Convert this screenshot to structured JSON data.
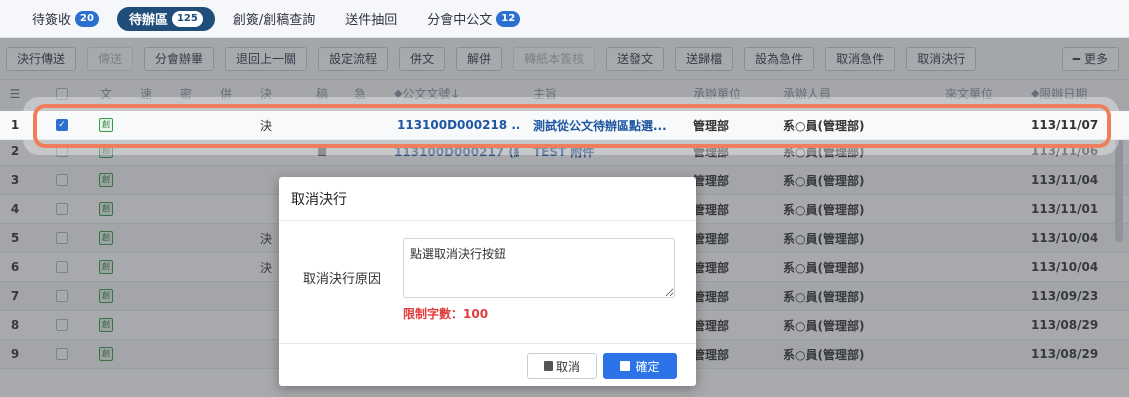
{
  "tabs": [
    {
      "label": "待簽收",
      "badge": "20"
    },
    {
      "label": "待辦區",
      "badge": "125"
    },
    {
      "label": "創簽/創稿查詢",
      "badge": ""
    },
    {
      "label": "送件抽回",
      "badge": ""
    },
    {
      "label": "分會中公文",
      "badge": "12"
    }
  ],
  "toolbar": {
    "buttons": [
      "決行傳送",
      "傳送",
      "分會辦畢",
      "退回上一關",
      "設定流程",
      "併文",
      "解併",
      "轉紙本簽核",
      "送發文",
      "送歸檔",
      "設為急件",
      "取消急件",
      "取消決行"
    ],
    "more": "更多"
  },
  "table": {
    "headers": {
      "wen": "文",
      "su": "速",
      "mi": "密",
      "bing": "併",
      "jue": "決",
      "gao": "稿",
      "ji": "急",
      "docno": "公文文號",
      "subject": "主旨",
      "unit": "承辦單位",
      "person": "承辦人員",
      "from": "來文單位",
      "date": "限辦日期"
    },
    "rows": [
      {
        "num": "1",
        "checked": true,
        "wen": "創",
        "jue": "決",
        "gao": false,
        "docno": "113100D000218 ...",
        "subject": "測試從公文待辦區點選...",
        "unit": "管理部",
        "person": "系○員(管理部)",
        "date": "113/11/07"
      },
      {
        "num": "2",
        "checked": false,
        "wen": "創",
        "jue": "",
        "gao": true,
        "docno": "113100D000217 (線)",
        "subject": "TEST 附件",
        "unit": "管理部",
        "person": "系○員(管理部)",
        "date": "113/11/06"
      },
      {
        "num": "3",
        "checked": false,
        "wen": "創",
        "jue": "",
        "gao": false,
        "docno": "",
        "subject": "",
        "unit": "管理部",
        "person": "系○員(管理部)",
        "date": "113/11/04"
      },
      {
        "num": "4",
        "checked": false,
        "wen": "創",
        "jue": "",
        "gao": false,
        "docno": "",
        "subject": "",
        "unit": "管理部",
        "person": "系○員(管理部)",
        "date": "113/11/01"
      },
      {
        "num": "5",
        "checked": false,
        "wen": "創",
        "jue": "決",
        "gao": false,
        "docno": "",
        "subject": "",
        "unit": "管理部",
        "person": "系○員(管理部)",
        "date": "113/10/04"
      },
      {
        "num": "6",
        "checked": false,
        "wen": "創",
        "jue": "決",
        "gao": false,
        "docno": "",
        "subject": "",
        "unit": "管理部",
        "person": "系○員(管理部)",
        "date": "113/10/04"
      },
      {
        "num": "7",
        "checked": false,
        "wen": "創",
        "jue": "",
        "gao": false,
        "docno": "",
        "subject": "",
        "unit": "管理部",
        "person": "系○員(管理部)",
        "date": "113/09/23"
      },
      {
        "num": "8",
        "checked": false,
        "wen": "創",
        "jue": "",
        "gao": false,
        "docno": "",
        "subject": "",
        "unit": "管理部",
        "person": "系○員(管理部)",
        "date": "113/08/29"
      },
      {
        "num": "9",
        "checked": false,
        "wen": "創",
        "jue": "",
        "gao": false,
        "docno": "",
        "subject": "",
        "unit": "管理部",
        "person": "系○員(管理部)",
        "date": "113/08/29"
      }
    ]
  },
  "dialog": {
    "title": "取消決行",
    "reason_label": "取消決行原因",
    "reason_value": "點選取消決行按鈕",
    "limit_text": "限制字數：100",
    "cancel_label": "取消",
    "ok_label": "確定"
  },
  "colors": {
    "accent": "#2b73e6",
    "highlight_ring": "#ef7f5c",
    "link": "#1e56a0",
    "limit_red": "#e23b3b"
  }
}
